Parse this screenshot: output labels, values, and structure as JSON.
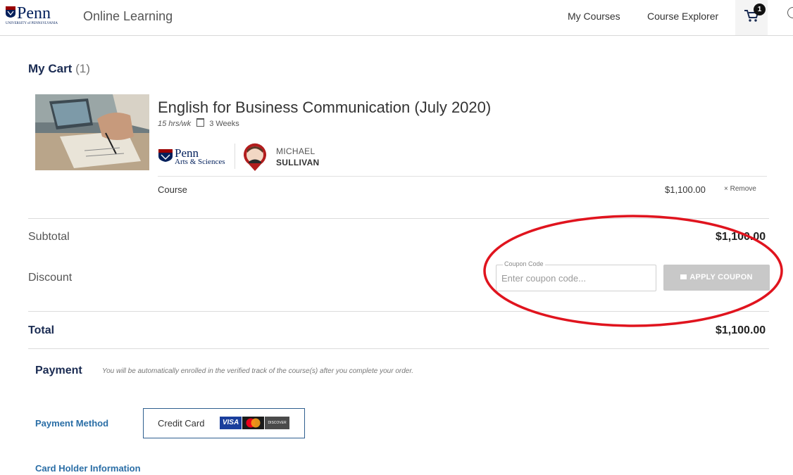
{
  "header": {
    "brand": "Penn",
    "brand_sub": "UNIVERSITY of PENNSYLVANIA",
    "app_title": "Online Learning",
    "nav": {
      "my_courses": "My Courses",
      "course_explorer": "Course Explorer"
    },
    "cart_badge": "1"
  },
  "cart": {
    "heading": "My Cart",
    "count": "(1)",
    "item": {
      "title": "English for Business Communication (July 2020)",
      "hours": "15 hrs/wk",
      "duration": "3 Weeks",
      "partner_name": "Penn",
      "partner_sub": "Arts & Sciences",
      "instructor_first": "MICHAEL",
      "instructor_last": "SULLIVAN",
      "type_label": "Course",
      "price": "$1,100.00",
      "remove_label": "Remove"
    },
    "subtotal_label": "Subtotal",
    "subtotal_value": "$1,100.00",
    "discount_label": "Discount",
    "coupon": {
      "legend": "Coupon Code",
      "placeholder": "Enter coupon code...",
      "apply_label": "APPLY COUPON"
    },
    "total_label": "Total",
    "total_value": "$1,100.00"
  },
  "payment": {
    "title": "Payment",
    "note": "You will be automatically enrolled in the verified track of the course(s) after you complete your order.",
    "method_label": "Payment Method",
    "method_value": "Credit Card",
    "cards": {
      "visa": "VISA",
      "discover": "DISCOVER"
    },
    "cardholder_label": "Card Holder Information"
  },
  "colors": {
    "navy": "#1a2b52",
    "link_blue": "#2a6ea6",
    "annotation_red": "#e0141e",
    "button_disabled": "#c8c8c8"
  }
}
